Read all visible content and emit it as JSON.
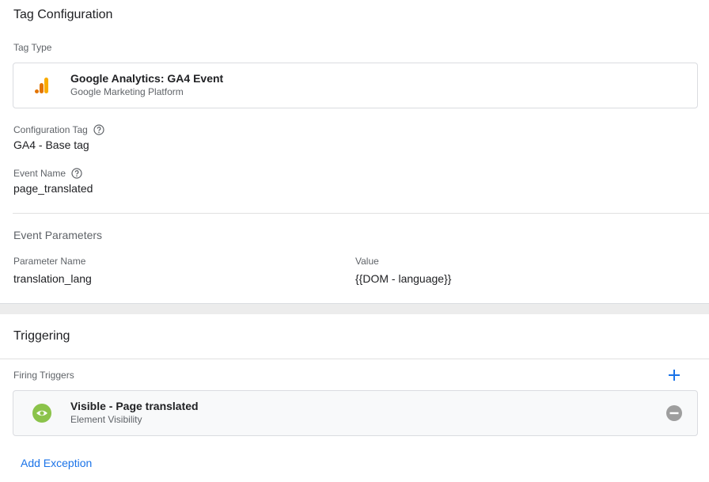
{
  "tag_configuration": {
    "title": "Tag Configuration",
    "tag_type": {
      "label": "Tag Type",
      "name": "Google Analytics: GA4 Event",
      "platform": "Google Marketing Platform",
      "icon": "google-analytics-icon"
    },
    "configuration_tag": {
      "label": "Configuration Tag",
      "value": "GA4 - Base tag"
    },
    "event_name": {
      "label": "Event Name",
      "value": "page_translated"
    },
    "event_parameters": {
      "title": "Event Parameters",
      "name_header": "Parameter Name",
      "value_header": "Value",
      "rows": [
        {
          "name": "translation_lang",
          "value": "{{DOM - language}}"
        }
      ]
    }
  },
  "triggering": {
    "title": "Triggering",
    "firing_triggers_label": "Firing Triggers",
    "triggers": [
      {
        "name": "Visible - Page translated",
        "type": "Element Visibility",
        "icon": "eye-icon"
      }
    ],
    "add_exception_label": "Add Exception"
  },
  "colors": {
    "accent": "#1a73e8",
    "trigger_icon": "#8bc34a",
    "ga_orange": "#f9ab00",
    "ga_dark_orange": "#e37400"
  }
}
